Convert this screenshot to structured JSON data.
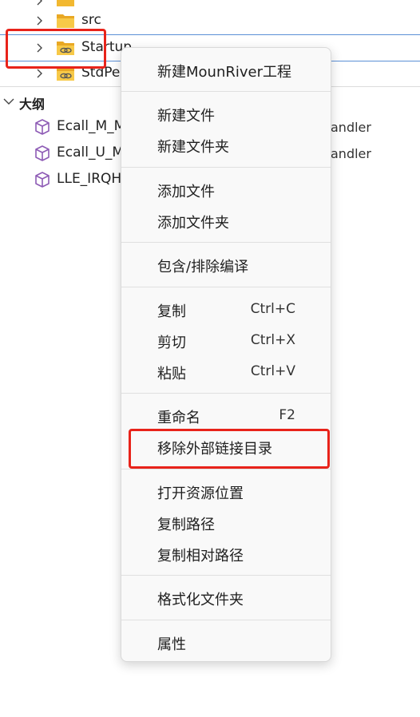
{
  "explorer": {
    "rows": [
      {
        "label": "src"
      },
      {
        "label": "Startup"
      },
      {
        "label": "StdPe"
      }
    ]
  },
  "outline": {
    "title": "大纲",
    "items": [
      {
        "label": "Ecall_M_M"
      },
      {
        "label": "Ecall_U_M"
      },
      {
        "label": "LLE_IRQH"
      }
    ],
    "truncated_suffixes": [
      "andler",
      "andler"
    ]
  },
  "context_menu": {
    "groups": [
      [
        {
          "label": "新建MounRiver工程",
          "shortcut": ""
        }
      ],
      [
        {
          "label": "新建文件",
          "shortcut": ""
        },
        {
          "label": "新建文件夹",
          "shortcut": ""
        }
      ],
      [
        {
          "label": "添加文件",
          "shortcut": ""
        },
        {
          "label": "添加文件夹",
          "shortcut": ""
        }
      ],
      [
        {
          "label": "包含/排除编译",
          "shortcut": ""
        }
      ],
      [
        {
          "label": "复制",
          "shortcut": "Ctrl+C"
        },
        {
          "label": "剪切",
          "shortcut": "Ctrl+X"
        },
        {
          "label": "粘贴",
          "shortcut": "Ctrl+V"
        }
      ],
      [
        {
          "label": "重命名",
          "shortcut": "F2"
        },
        {
          "label": "移除外部链接目录",
          "shortcut": ""
        }
      ],
      [
        {
          "label": "打开资源位置",
          "shortcut": ""
        },
        {
          "label": "复制路径",
          "shortcut": ""
        },
        {
          "label": "复制相对路径",
          "shortcut": ""
        }
      ],
      [
        {
          "label": "格式化文件夹",
          "shortcut": ""
        }
      ],
      [
        {
          "label": "属性",
          "shortcut": ""
        }
      ]
    ]
  },
  "colors": {
    "highlight_red": "#e8231a",
    "selection_blue": "#5b8fd6",
    "folder_yellow": "#f2b830",
    "cube_purple": "#8e5bb5"
  }
}
